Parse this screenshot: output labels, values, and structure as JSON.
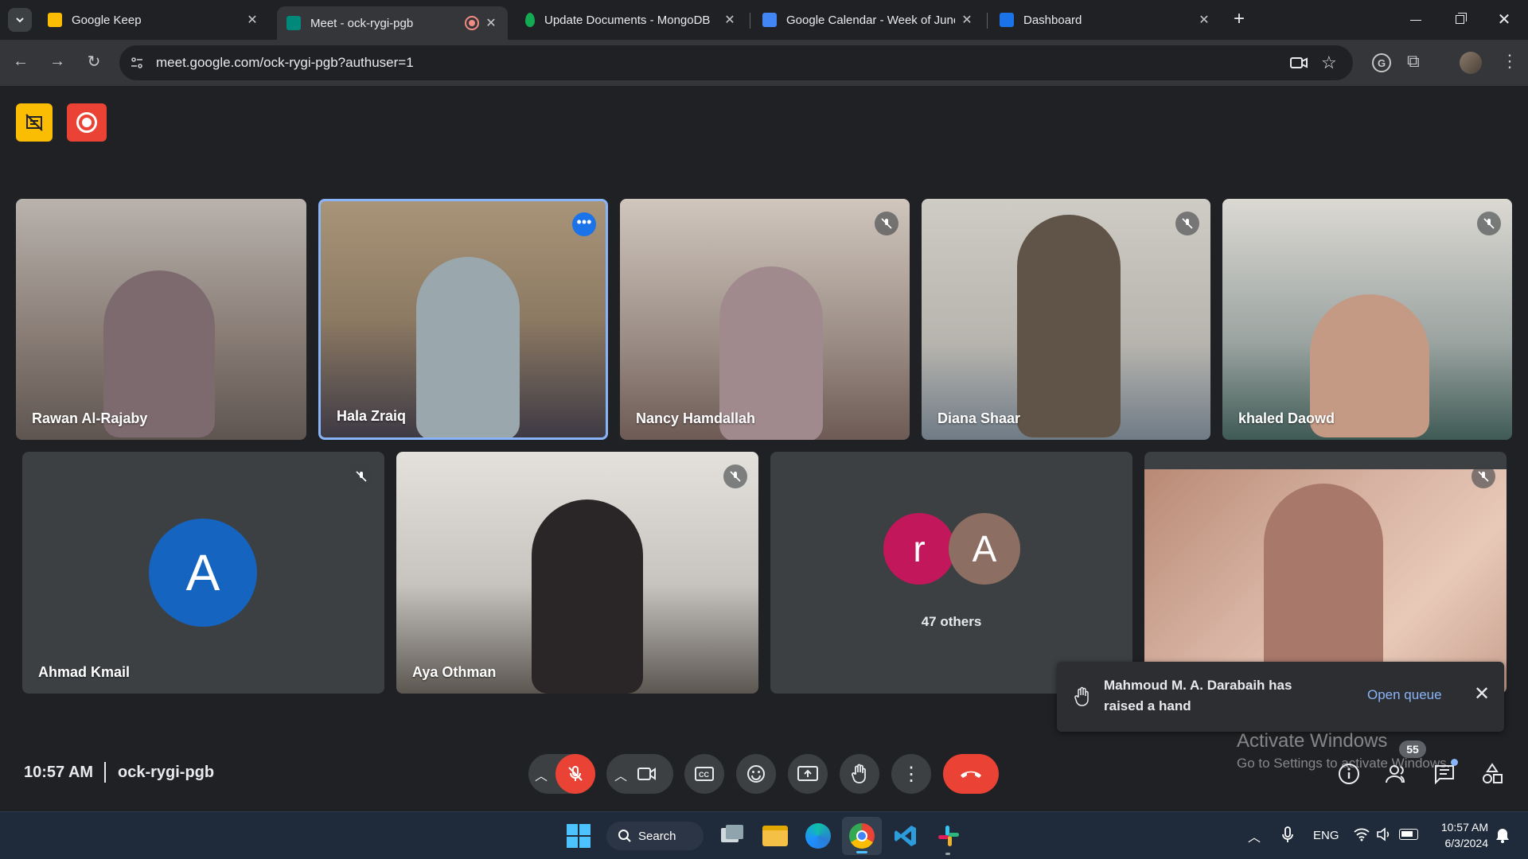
{
  "browser": {
    "tabs": [
      {
        "title": "Google Keep",
        "favicon_color": "#fbbc04",
        "active": false
      },
      {
        "title": "Meet - ock-rygi-pgb",
        "favicon_color": "#00897b",
        "active": true
      },
      {
        "title": "Update Documents - MongoDB",
        "favicon_color": "#13aa52",
        "active": false
      },
      {
        "title": "Google Calendar - Week of June",
        "favicon_color": "#4285f4",
        "active": false
      },
      {
        "title": "Dashboard",
        "favicon_color": "#1a73e8",
        "active": false
      }
    ],
    "url": "meet.google.com/ock-rygi-pgb?authuser=1"
  },
  "meet": {
    "participants": [
      {
        "name": "Rawan Al-Rajaby",
        "muted": false,
        "bg": "#8a7e77"
      },
      {
        "name": "Hala Zraiq",
        "muted": false,
        "bg": "#8d7a63",
        "active_speaker": true
      },
      {
        "name": "Nancy Hamdallah",
        "muted": true,
        "bg": "#9a8c84"
      },
      {
        "name": "Diana Shaar",
        "muted": true,
        "bg": "#b7b4ae"
      },
      {
        "name": "khaled Daowd",
        "muted": true,
        "bg": "#9aa3a0"
      },
      {
        "name": "Ahmad Kmail",
        "muted": true,
        "avatar_letter": "A",
        "avatar_color": "#1565c0"
      },
      {
        "name": "Aya Othman",
        "muted": true,
        "bg": "#c7c4c0"
      },
      {
        "name": "",
        "muted": true,
        "bg": "#c9a090"
      }
    ],
    "others": {
      "label": "47 others",
      "avatars": [
        {
          "letter": "r",
          "color": "#c2185b"
        },
        {
          "letter": "A",
          "color": "#8d6e63"
        }
      ]
    },
    "notification": {
      "text_line1": "Mahmoud M. A. Darabaih has",
      "text_line2": "raised a hand",
      "action": "Open queue"
    },
    "time": "10:57 AM",
    "meeting_code": "ock-rygi-pgb",
    "participant_count": "55",
    "watermark_title": "Activate Windows",
    "watermark_sub": "Go to Settings to activate Windows."
  },
  "taskbar": {
    "search_label": "Search",
    "lang": "ENG",
    "time": "10:57 AM",
    "date": "6/3/2024"
  }
}
